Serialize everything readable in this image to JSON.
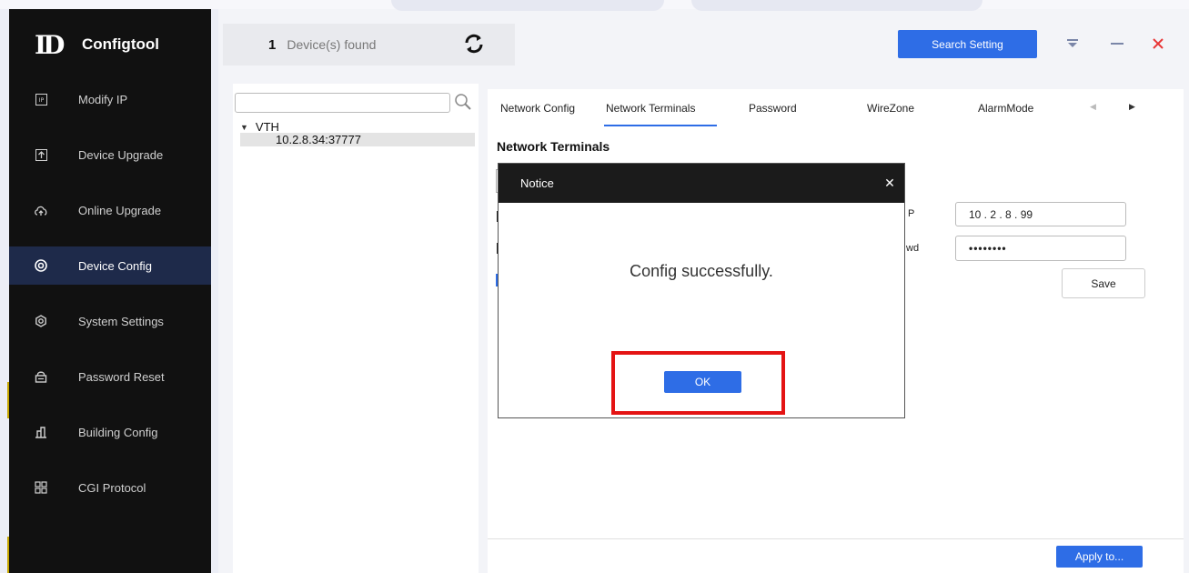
{
  "app": {
    "logo_mark": "ID",
    "logo_text": "Configtool"
  },
  "sidebar": {
    "items": [
      {
        "label": "Modify IP",
        "icon": "ip-icon"
      },
      {
        "label": "Device Upgrade",
        "icon": "upload-icon"
      },
      {
        "label": "Online Upgrade",
        "icon": "cloud-upload-icon"
      },
      {
        "label": "Device Config",
        "icon": "target-icon",
        "active": true
      },
      {
        "label": "System Settings",
        "icon": "gear-icon"
      },
      {
        "label": "Password Reset",
        "icon": "lock-icon"
      },
      {
        "label": "Building Config",
        "icon": "building-icon"
      },
      {
        "label": "CGI Protocol",
        "icon": "grid-icon"
      }
    ]
  },
  "topbar": {
    "device_count": "1",
    "device_count_label": "Device(s) found",
    "search_setting_label": "Search Setting"
  },
  "tree": {
    "search_value": "",
    "root_label": "VTH",
    "child_label": "10.2.8.34:37777"
  },
  "content": {
    "tabs": [
      "Network Config",
      "Network Terminals",
      "Password",
      "WireZone",
      "AlarmMode"
    ],
    "active_tab": "Network Terminals",
    "section_title": "Network Terminals",
    "ip_value": "10 . 2 . 8 . 99",
    "ip_label_fragment": "P",
    "pwd_label_fragment": "wd",
    "pwd_value": "••••••••",
    "save_label": "Save",
    "apply_label": "Apply to..."
  },
  "modal": {
    "title": "Notice",
    "message": "Config successfully.",
    "ok_label": "OK"
  },
  "colors": {
    "accent": "#2e6de6",
    "sidebar_bg": "#111111",
    "sidebar_active": "#1e2a4a",
    "highlight": "#e41313",
    "close_red": "#e83535"
  }
}
